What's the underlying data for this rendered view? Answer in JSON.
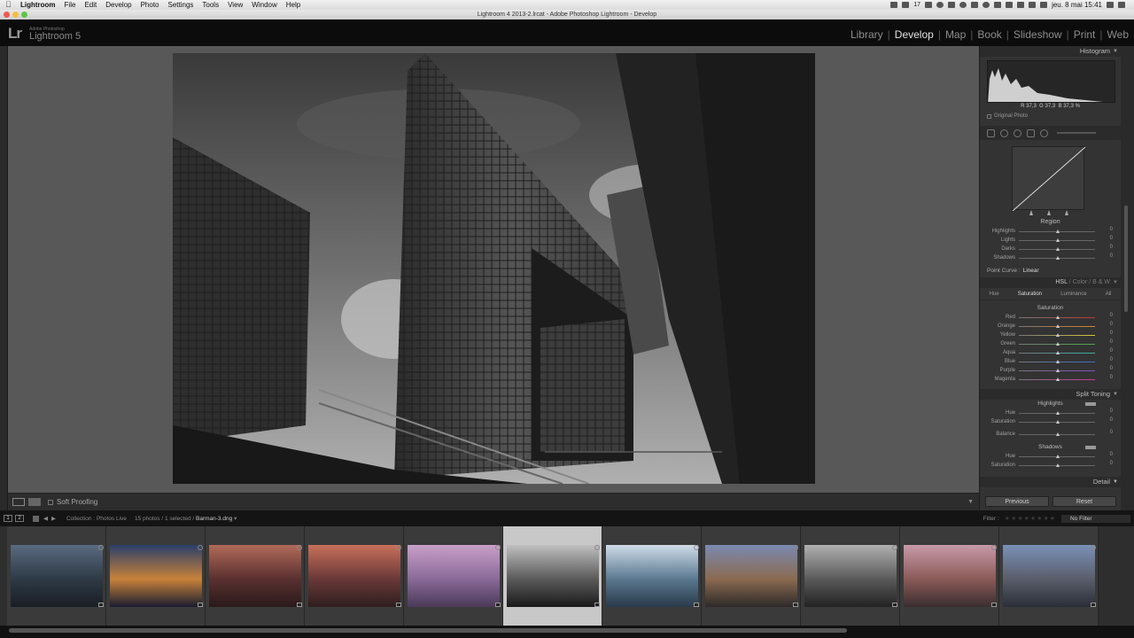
{
  "menubar": {
    "app": "Lightroom",
    "items": [
      "File",
      "Edit",
      "Develop",
      "Photo",
      "Settings",
      "Tools",
      "View",
      "Window",
      "Help"
    ],
    "clock": "jeu. 8 mai  15:41",
    "battery": "17"
  },
  "window": {
    "title": "Lightroom 4 2013-2.lrcat - Adobe Photoshop Lightroom - Develop"
  },
  "identity": {
    "logo": "Lr",
    "vendor": "Adobe Photoshop",
    "product": "Lightroom 5"
  },
  "modules": [
    {
      "label": "Library",
      "active": false
    },
    {
      "label": "Develop",
      "active": true
    },
    {
      "label": "Map",
      "active": false
    },
    {
      "label": "Book",
      "active": false
    },
    {
      "label": "Slideshow",
      "active": false
    },
    {
      "label": "Print",
      "active": false
    },
    {
      "label": "Web",
      "active": false
    }
  ],
  "toolbar": {
    "soft_proofing": "Soft Proofing"
  },
  "histogram": {
    "title": "Histogram",
    "r_label": "R",
    "r": "37,3",
    "g_label": "G",
    "g": "37,3",
    "b_label": "B",
    "b": "37,3",
    "unit": "%",
    "original_photo": "Original Photo"
  },
  "tone_curve": {
    "region_title": "Region",
    "sliders": [
      {
        "label": "Highlights",
        "value": "0"
      },
      {
        "label": "Lights",
        "value": "0"
      },
      {
        "label": "Darks",
        "value": "0"
      },
      {
        "label": "Shadows",
        "value": "0"
      }
    ],
    "point_curve_label": "Point Curve :",
    "point_curve_value": "Linear"
  },
  "hsl": {
    "header_hsl": "HSL",
    "header_color": "Color",
    "header_bw": "B & W",
    "tabs": [
      "Hue",
      "Saturation",
      "Luminance",
      "All"
    ],
    "active_tab": "Saturation",
    "section_title": "Saturation",
    "sliders": [
      {
        "label": "Red",
        "value": "0",
        "color": "#c0392b"
      },
      {
        "label": "Orange",
        "value": "0",
        "color": "#d9812a"
      },
      {
        "label": "Yellow",
        "value": "0",
        "color": "#d8c53a"
      },
      {
        "label": "Green",
        "value": "0",
        "color": "#4aa84a"
      },
      {
        "label": "Aqua",
        "value": "0",
        "color": "#3ab0a8"
      },
      {
        "label": "Blue",
        "value": "0",
        "color": "#3a6ad0"
      },
      {
        "label": "Purple",
        "value": "0",
        "color": "#8a4ac8"
      },
      {
        "label": "Magenta",
        "value": "0",
        "color": "#c43a9a"
      }
    ]
  },
  "split_toning": {
    "title": "Split Toning",
    "highlights_title": "Highlights",
    "highlights": [
      {
        "label": "Hue",
        "value": "0"
      },
      {
        "label": "Saturation",
        "value": "0"
      }
    ],
    "balance": {
      "label": "Balance",
      "value": "0"
    },
    "shadows_title": "Shadows",
    "shadows": [
      {
        "label": "Hue",
        "value": "0"
      },
      {
        "label": "Saturation",
        "value": "0"
      }
    ]
  },
  "detail": {
    "title": "Detail"
  },
  "buttons": {
    "previous": "Previous",
    "reset": "Reset"
  },
  "filmstrip_bar": {
    "page1": "1",
    "page2": "2",
    "collection": "Collection : Photos Live",
    "count": "15 photos / 1 selected /",
    "filename": "Barman-3.dng",
    "filter_label": "Filter :",
    "filter_value": "No Filter"
  },
  "filmstrip": {
    "selected_index": 5,
    "thumbnails": [
      {
        "name": "dusk-river-bridge",
        "palette": [
          "#5a6a80",
          "#2e3a46",
          "#1a1e24"
        ]
      },
      {
        "name": "night-city-lights",
        "palette": [
          "#2a3e6a",
          "#c8823a",
          "#1a1c30"
        ]
      },
      {
        "name": "pier-sunset-red",
        "palette": [
          "#b06a58",
          "#5a3030",
          "#2a1a1a"
        ]
      },
      {
        "name": "pier-sunset-orange",
        "palette": [
          "#c8705a",
          "#6a3838",
          "#2e1e1e"
        ]
      },
      {
        "name": "pier-sunset-violet",
        "palette": [
          "#c8a0c8",
          "#8a6a98",
          "#4a3a58"
        ]
      },
      {
        "name": "bw-buildings-selected",
        "palette": [
          "#c0c0c0",
          "#5a5a5a",
          "#1a1a1a"
        ]
      },
      {
        "name": "blue-towers",
        "palette": [
          "#d0dce8",
          "#5a7890",
          "#2a3a4a"
        ]
      },
      {
        "name": "notre-dame-evening",
        "palette": [
          "#7a8ab0",
          "#8a6a50",
          "#2e2a2a"
        ]
      },
      {
        "name": "notre-dame-bw",
        "palette": [
          "#b0b0b0",
          "#5a5a5a",
          "#222222"
        ]
      },
      {
        "name": "notre-dame-sunset",
        "palette": [
          "#c89aa8",
          "#8a5a58",
          "#3a2e30"
        ]
      },
      {
        "name": "notre-dame-quay",
        "palette": [
          "#7a90b8",
          "#5a5e6a",
          "#2a2e38"
        ]
      }
    ]
  }
}
